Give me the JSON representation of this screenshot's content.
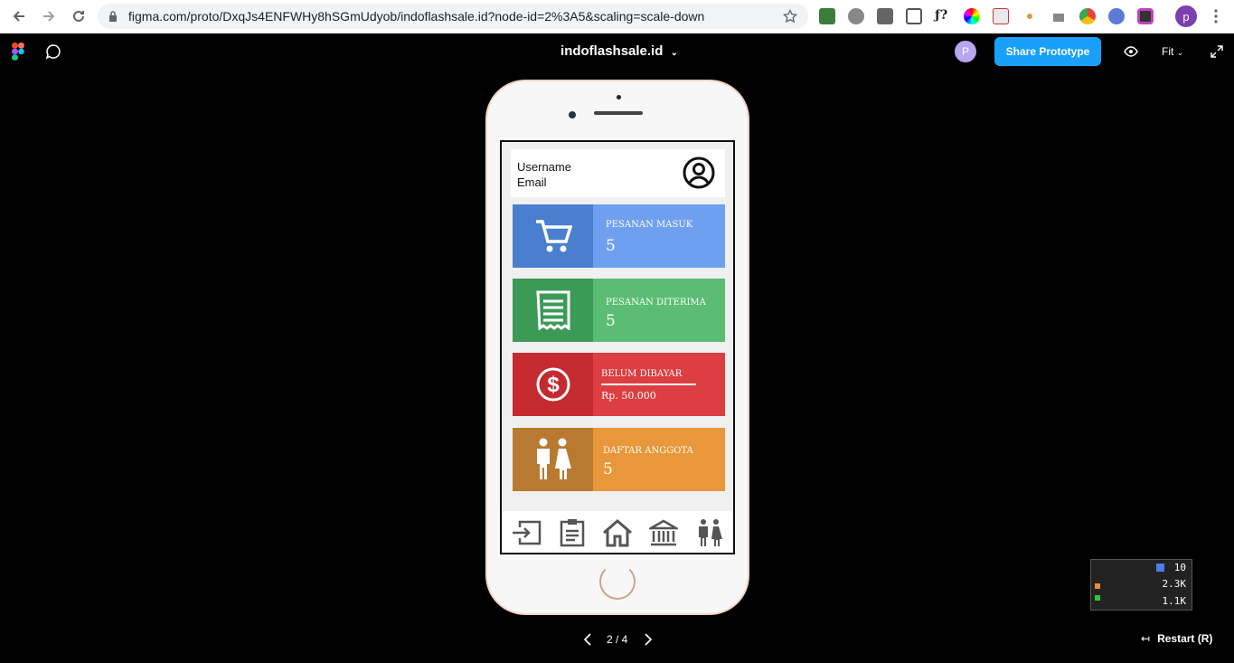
{
  "browser": {
    "url": "figma.com/proto/DxqJs4ENFWHy8hSGmUdyob/indoflashsale.id?node-id=2%3A5&scaling=scale-down",
    "profile_initial": "p"
  },
  "figma": {
    "file_title": "indoflashsale.id",
    "avatar_initial": "P",
    "share_label": "Share Prototype",
    "fit_label": "Fit",
    "pager": "2 / 4",
    "restart_label": "Restart (R)"
  },
  "app": {
    "profile": {
      "username": "Username",
      "email": "Email"
    },
    "tiles": [
      {
        "label": "PESANAN MASUK",
        "value": "5",
        "icon": "cart-icon",
        "icon_bg": "#4a7fcf",
        "bg": "#6fa0ef"
      },
      {
        "label": "PESANAN DITERIMA",
        "value": "5",
        "icon": "receipt-icon",
        "icon_bg": "#3c9a57",
        "bg": "#5bbd73"
      },
      {
        "label": "BELUM DIBAYAR",
        "value": "Rp. 50.000",
        "icon": "dollar-icon",
        "icon_bg": "#c52a2f",
        "bg": "#dc3e42"
      },
      {
        "label": "DAFTAR ANGGOTA",
        "value": "5",
        "icon": "people-icon",
        "icon_bg": "#b87a30",
        "bg": "#e8973a"
      }
    ],
    "bottom_nav": [
      "login-icon",
      "clipboard-icon",
      "home-icon",
      "bank-icon",
      "people-icon"
    ]
  },
  "perf_overlay": {
    "v1": "10",
    "v2": "2.3K",
    "v3": "1.1K"
  },
  "colors": {
    "figma_blue": "#18a0fb",
    "phone_border": "#f1d4c5"
  }
}
